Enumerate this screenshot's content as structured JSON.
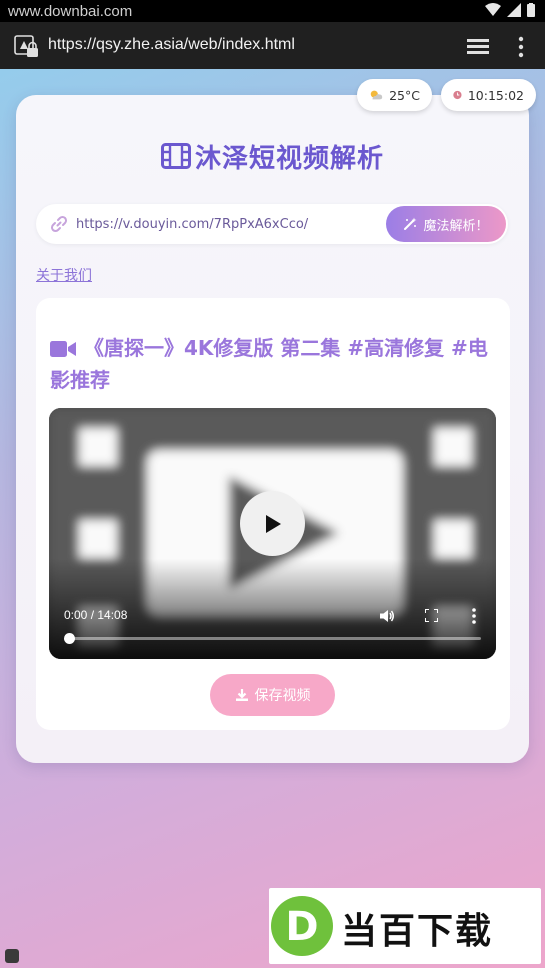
{
  "status_bar": {
    "watermark": "www.downbai.com"
  },
  "browser": {
    "url": "https://qsy.zhe.asia/web/index.html"
  },
  "widgets": {
    "weather": "25°C",
    "time": "10:15:02"
  },
  "app": {
    "title": "沐泽短视频解析",
    "input_value": "https://v.douyin.com/7RpPxA6xCco/",
    "parse_button": "魔法解析！",
    "about_link": "关于我们"
  },
  "result": {
    "video_title": "《唐探一》4K修复版 第二集 #高清修复 #电影推荐",
    "time_display": "0:00 / 14:08",
    "progress": 0,
    "save_button": "保存视频"
  },
  "watermark": {
    "brand": "当百下载",
    "logo_letter": "D"
  },
  "colors": {
    "accent": "#6b58cf",
    "title_purple": "#9a76dc",
    "pink": "#f7a8c8"
  }
}
